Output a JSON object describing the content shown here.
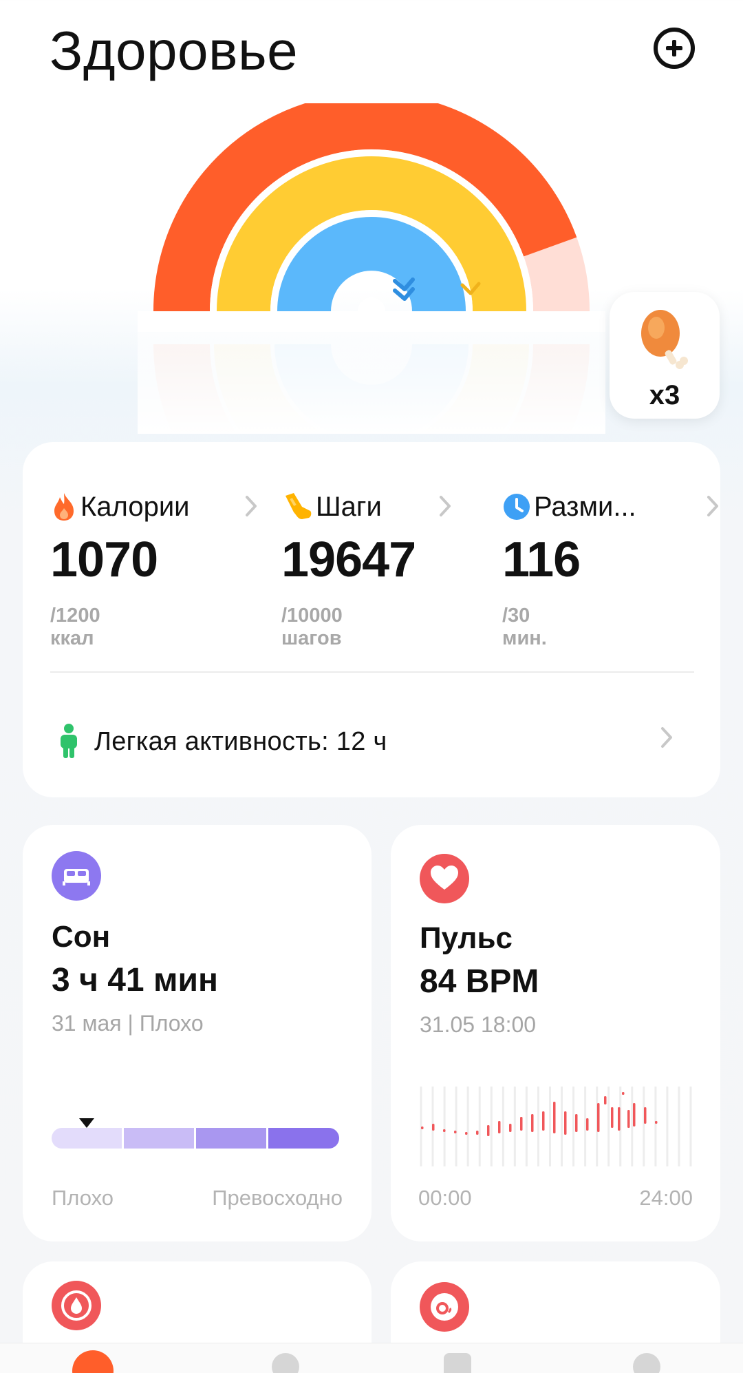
{
  "header": {
    "title": "Здоровье"
  },
  "rings": {
    "calories_progress": 0.89,
    "steps_progress": 1.0,
    "minutes_progress": 1.0,
    "colors": {
      "calories": "#ff5e2a",
      "calories_track": "#ffded6",
      "steps": "#ffcc33",
      "minutes": "#5bb8fb"
    }
  },
  "reward": {
    "icon": "chicken-leg-icon",
    "count": "x3"
  },
  "activity": {
    "metrics": [
      {
        "icon": "flame-icon",
        "name": "Калории",
        "value": "1070",
        "goal": "/1200 ккал",
        "color": "#ff6a2b"
      },
      {
        "icon": "shoe-icon",
        "name": "Шаги",
        "value": "19647",
        "goal": "/10000 шагов",
        "color": "#ffb300"
      },
      {
        "icon": "clock-icon",
        "name": "Разми...",
        "value": "116",
        "goal": "/30 мин.",
        "color": "#3ea0f5"
      }
    ],
    "light_activity": "Легкая активность: 12 ч"
  },
  "sleep": {
    "icon": "bed-icon",
    "title": "Сон",
    "value": "3 ч 41 мин",
    "subtitle": "31 мая | Плохо",
    "scale_min_label": "Плохо",
    "scale_max_label": "Превосходно",
    "quality_level": 0.12,
    "colors": [
      "#e3dcfb",
      "#c9bcf6",
      "#a997f0",
      "#8a72ec"
    ]
  },
  "pulse": {
    "icon": "heart-icon",
    "title": "Пульс",
    "value": "84 BPM",
    "subtitle": "31.05 18:00",
    "axis_start": "00:00",
    "axis_end": "24:00",
    "color": "#f0575a"
  },
  "blood_pressure": {
    "icon": "blood-drop-icon",
    "color": "#f0575a"
  },
  "spo2": {
    "icon": "oxygen-icon",
    "color": "#f0575a"
  },
  "bottom_nav": {
    "items": [
      "nav-health-icon",
      "nav-workout-icon",
      "nav-device-icon",
      "nav-profile-icon"
    ]
  }
}
